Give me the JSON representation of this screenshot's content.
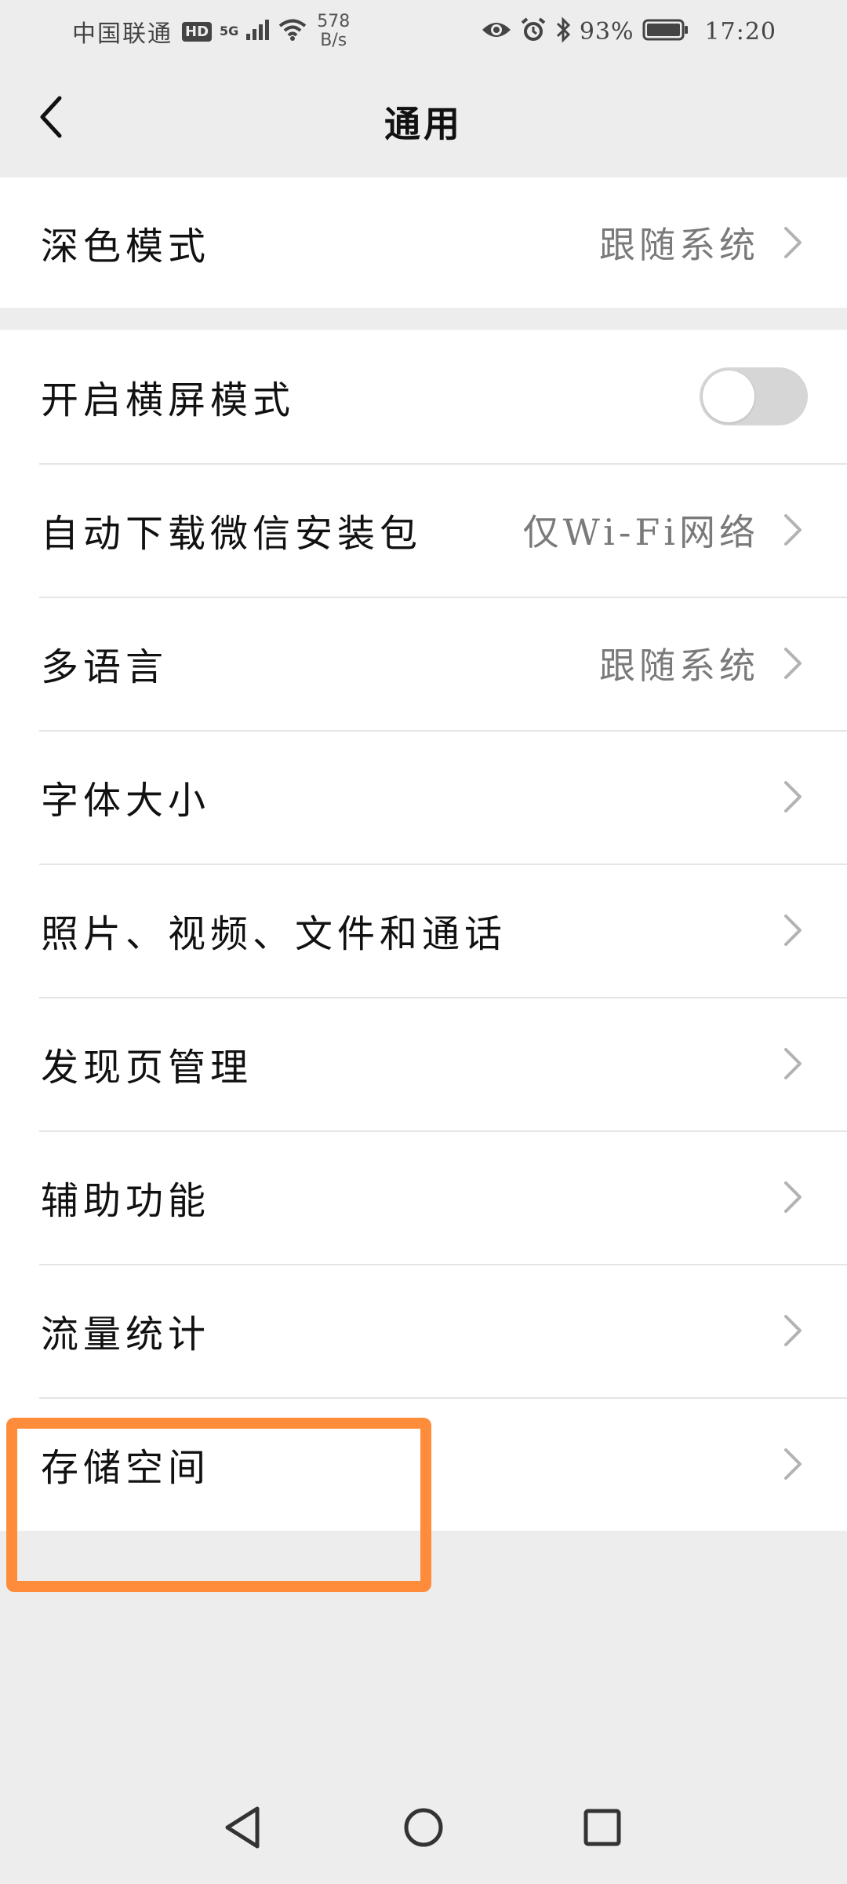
{
  "status_bar": {
    "carrier": "中国联通",
    "hd_badge": "HD",
    "network_gen": "5G",
    "speed_value": "578",
    "speed_unit": "B/s",
    "battery": "93%",
    "time": "17:20",
    "icons": [
      "signal-icon",
      "wifi-icon",
      "eye-icon",
      "alarm-icon",
      "bluetooth-icon",
      "battery-icon"
    ]
  },
  "nav": {
    "title": "通用",
    "back_icon": "chevron-left-icon"
  },
  "group1": {
    "dark_mode": {
      "label": "深色模式",
      "value": "跟随系统"
    }
  },
  "group2": {
    "landscape": {
      "label": "开启横屏模式",
      "toggle_on": false
    },
    "auto_download": {
      "label": "自动下载微信安装包",
      "value": "仅Wi-Fi网络"
    },
    "language": {
      "label": "多语言",
      "value": "跟随系统"
    },
    "font_size": {
      "label": "字体大小"
    },
    "media": {
      "label": "照片、视频、文件和通话"
    },
    "discover": {
      "label": "发现页管理"
    },
    "accessibility": {
      "label": "辅助功能"
    },
    "traffic": {
      "label": "流量统计"
    },
    "storage": {
      "label": "存储空间"
    }
  },
  "colors": {
    "background": "#ededed",
    "card": "#ffffff",
    "highlight": "#ff8c3a",
    "secondary_text": "#7a7a7a",
    "toggle_off": "#d6d6d6"
  },
  "system_nav": {
    "icons": [
      "triangle-back-icon",
      "circle-home-icon",
      "square-recent-icon"
    ]
  }
}
